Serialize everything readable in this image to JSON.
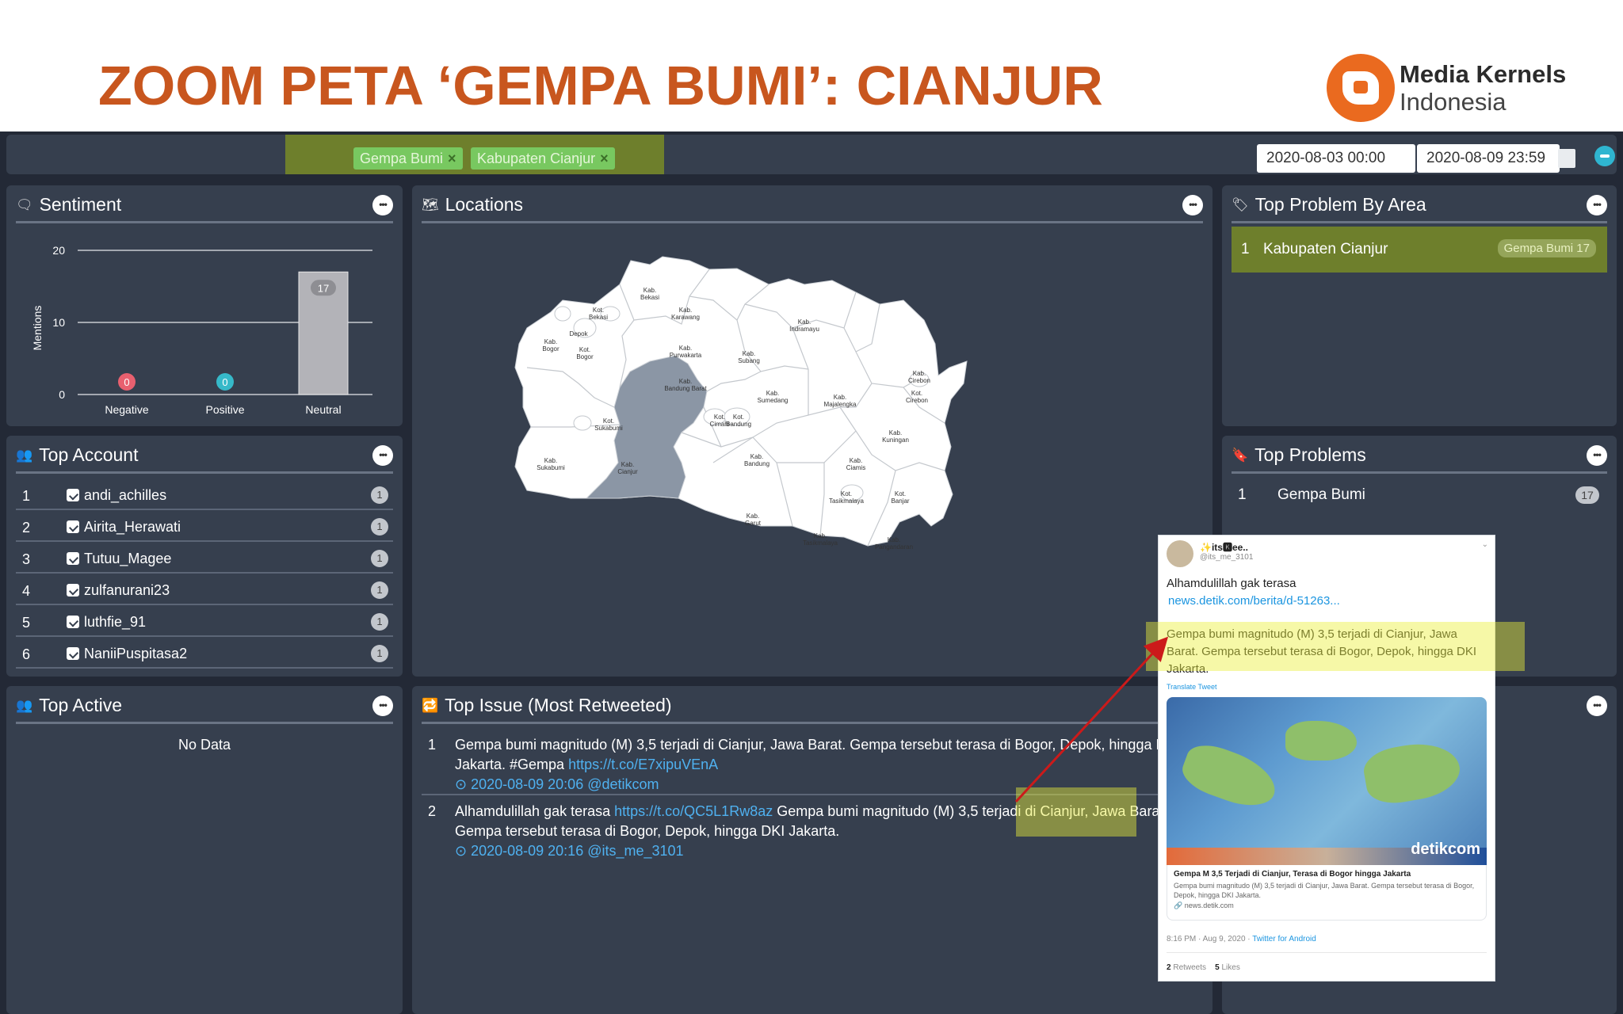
{
  "slide": {
    "title": "ZOOM PETA ‘GEMPA BUMI’: CIANJUR",
    "logo_line1": "Media Kernels",
    "logo_line2": "Indonesia"
  },
  "filters": {
    "chips": [
      "Gempa Bumi",
      "Kabupaten Cianjur"
    ],
    "remove_glyph": "×",
    "date_from": "2020-08-03 00:00",
    "date_to": "2020-08-09 23:59"
  },
  "sentiment": {
    "title": "Sentiment",
    "menu": "•••"
  },
  "chart_data": {
    "type": "bar",
    "categories": [
      "Negative",
      "Positive",
      "Neutral"
    ],
    "values": [
      0,
      0,
      17
    ],
    "ylabel": "Mentions",
    "ylim": [
      0,
      20
    ],
    "yticks": [
      0,
      10,
      20
    ],
    "label_colors": [
      "#e8606f",
      "#36b9c9",
      "#8e8e93"
    ],
    "bar_color": "#b3b3b8"
  },
  "locations": {
    "title": "Locations",
    "menu": "•••",
    "highlighted_region": "Kab. Cianjur",
    "labels": [
      {
        "name": "Kab. Bekasi"
      },
      {
        "name": "Kab. Karawang"
      },
      {
        "name": "Kot. Bekasi"
      },
      {
        "name": "Depok"
      },
      {
        "name": "Kab. Bogor"
      },
      {
        "name": "Kot. Bogor"
      },
      {
        "name": "Kab. Purwakarta"
      },
      {
        "name": "Kab. Subang"
      },
      {
        "name": "Kab. Indramayu"
      },
      {
        "name": "Kab. Bandung Barat"
      },
      {
        "name": "Kot. Sukabumi"
      },
      {
        "name": "Kab. Sumedang"
      },
      {
        "name": "Kab. Majalengka"
      },
      {
        "name": "Kab. Cirebon"
      },
      {
        "name": "Kot. Cirebon"
      },
      {
        "name": "Kot. Cimahi"
      },
      {
        "name": "Kot. Bandung"
      },
      {
        "name": "Kab. Kuningan"
      },
      {
        "name": "Kab. Sukabumi"
      },
      {
        "name": "Kab. Cianjur"
      },
      {
        "name": "Kab. Bandung"
      },
      {
        "name": "Kab. Ciamis"
      },
      {
        "name": "Kot. Tasikmalaya"
      },
      {
        "name": "Kot. Banjar"
      },
      {
        "name": "Kab. Garut"
      },
      {
        "name": "Kab. Tasikmalaya"
      },
      {
        "name": "Kab. Pangandaran"
      }
    ]
  },
  "top_problem_by_area": {
    "title": "Top Problem By Area",
    "menu": "•••",
    "rows": [
      {
        "num": "1",
        "name": "Kabupaten Cianjur",
        "badge": "Gempa Bumi 17"
      }
    ]
  },
  "top_account": {
    "title": "Top Account",
    "menu": "•••",
    "rows": [
      {
        "num": "1",
        "name": "andi_achilles",
        "count": "1"
      },
      {
        "num": "2",
        "name": "Airita_Herawati",
        "count": "1"
      },
      {
        "num": "3",
        "name": "Tutuu_Magee",
        "count": "1"
      },
      {
        "num": "4",
        "name": "zulfanurani23",
        "count": "1"
      },
      {
        "num": "5",
        "name": "luthfie_91",
        "count": "1"
      },
      {
        "num": "6",
        "name": "NaniiPuspitasa2",
        "count": "1"
      }
    ]
  },
  "top_problems": {
    "title": "Top Problems",
    "menu": "•••",
    "rows": [
      {
        "num": "1",
        "name": "Gempa Bumi",
        "count": "17"
      }
    ]
  },
  "top_active": {
    "title": "Top Active",
    "menu": "•••",
    "empty": "No Data"
  },
  "top_issue": {
    "title": "Top Issue (Most Retweeted)",
    "menu": "•••",
    "items": [
      {
        "num": "1",
        "text_before": "Gempa bumi magnitudo (M) 3,5 terjadi di Cianjur, Jawa Barat. Gempa tersebut terasa di Bogor, Depok, hingga DKI Jakarta. #Gempa ",
        "link": "https://t.co/E7xipuVEnA",
        "text_after": "",
        "meta": "⊙ 2020-08-09 20:06 @detikcom"
      },
      {
        "num": "2",
        "text_before": "Alhamdulillah gak terasa ",
        "link": "https://t.co/QC5L1Rw8az",
        "text_after": " Gempa bumi magnitudo (M) 3,5 terjadi di Cianjur, Jawa Barat. Gempa tersebut terasa di Bogor, Depok, hingga DKI Jakarta.",
        "meta": "⊙ 2020-08-09 20:16 @its_me_3101"
      }
    ]
  },
  "right_bottom": {
    "menu": "•••"
  },
  "tweet": {
    "username": "✨its🅺ee..",
    "handle": "@its_me_3101",
    "chevron": "⌄",
    "line1": "Alhamdulillah gak terasa",
    "link": "news.detik.com/berita/d-51263...",
    "quote": "Gempa bumi magnitudo (M) 3,5 terjadi di Cianjur, Jawa Barat. Gempa tersebut terasa di Bogor, Depok, hingga DKI Jakarta.",
    "translate": "Translate Tweet",
    "image_brand": "detikcom",
    "card_title": "Gempa M 3,5 Terjadi di Cianjur, Terasa di Bogor hingga Jakarta",
    "card_desc": "Gempa bumi magnitudo (M) 3,5 terjadi di Cianjur, Jawa Barat. Gempa tersebut terasa di Bogor, Depok, hingga DKI Jakarta.",
    "card_domain": "🔗 news.detik.com",
    "time": "8:16 PM · Aug 9, 2020 · ",
    "via": "Twitter for Android",
    "retweets": "2",
    "retweets_label": " Retweets",
    "likes": "5",
    "likes_label": " Likes"
  }
}
